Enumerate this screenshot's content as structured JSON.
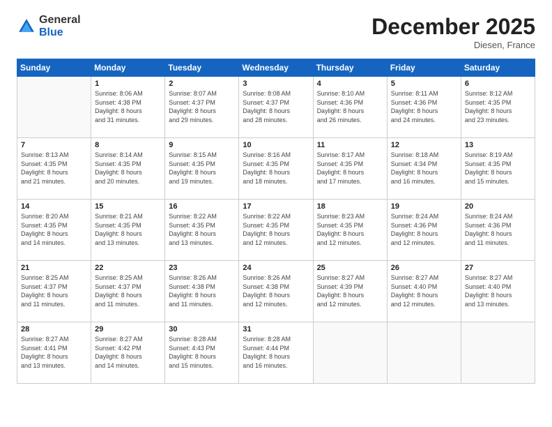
{
  "header": {
    "logo": {
      "general": "General",
      "blue": "Blue"
    },
    "title": "December 2025",
    "location": "Diesen, France"
  },
  "calendar": {
    "days_of_week": [
      "Sunday",
      "Monday",
      "Tuesday",
      "Wednesday",
      "Thursday",
      "Friday",
      "Saturday"
    ],
    "weeks": [
      [
        {
          "day": "",
          "info": ""
        },
        {
          "day": "1",
          "info": "Sunrise: 8:06 AM\nSunset: 4:38 PM\nDaylight: 8 hours\nand 31 minutes."
        },
        {
          "day": "2",
          "info": "Sunrise: 8:07 AM\nSunset: 4:37 PM\nDaylight: 8 hours\nand 29 minutes."
        },
        {
          "day": "3",
          "info": "Sunrise: 8:08 AM\nSunset: 4:37 PM\nDaylight: 8 hours\nand 28 minutes."
        },
        {
          "day": "4",
          "info": "Sunrise: 8:10 AM\nSunset: 4:36 PM\nDaylight: 8 hours\nand 26 minutes."
        },
        {
          "day": "5",
          "info": "Sunrise: 8:11 AM\nSunset: 4:36 PM\nDaylight: 8 hours\nand 24 minutes."
        },
        {
          "day": "6",
          "info": "Sunrise: 8:12 AM\nSunset: 4:35 PM\nDaylight: 8 hours\nand 23 minutes."
        }
      ],
      [
        {
          "day": "7",
          "info": "Sunrise: 8:13 AM\nSunset: 4:35 PM\nDaylight: 8 hours\nand 21 minutes."
        },
        {
          "day": "8",
          "info": "Sunrise: 8:14 AM\nSunset: 4:35 PM\nDaylight: 8 hours\nand 20 minutes."
        },
        {
          "day": "9",
          "info": "Sunrise: 8:15 AM\nSunset: 4:35 PM\nDaylight: 8 hours\nand 19 minutes."
        },
        {
          "day": "10",
          "info": "Sunrise: 8:16 AM\nSunset: 4:35 PM\nDaylight: 8 hours\nand 18 minutes."
        },
        {
          "day": "11",
          "info": "Sunrise: 8:17 AM\nSunset: 4:35 PM\nDaylight: 8 hours\nand 17 minutes."
        },
        {
          "day": "12",
          "info": "Sunrise: 8:18 AM\nSunset: 4:34 PM\nDaylight: 8 hours\nand 16 minutes."
        },
        {
          "day": "13",
          "info": "Sunrise: 8:19 AM\nSunset: 4:35 PM\nDaylight: 8 hours\nand 15 minutes."
        }
      ],
      [
        {
          "day": "14",
          "info": "Sunrise: 8:20 AM\nSunset: 4:35 PM\nDaylight: 8 hours\nand 14 minutes."
        },
        {
          "day": "15",
          "info": "Sunrise: 8:21 AM\nSunset: 4:35 PM\nDaylight: 8 hours\nand 13 minutes."
        },
        {
          "day": "16",
          "info": "Sunrise: 8:22 AM\nSunset: 4:35 PM\nDaylight: 8 hours\nand 13 minutes."
        },
        {
          "day": "17",
          "info": "Sunrise: 8:22 AM\nSunset: 4:35 PM\nDaylight: 8 hours\nand 12 minutes."
        },
        {
          "day": "18",
          "info": "Sunrise: 8:23 AM\nSunset: 4:35 PM\nDaylight: 8 hours\nand 12 minutes."
        },
        {
          "day": "19",
          "info": "Sunrise: 8:24 AM\nSunset: 4:36 PM\nDaylight: 8 hours\nand 12 minutes."
        },
        {
          "day": "20",
          "info": "Sunrise: 8:24 AM\nSunset: 4:36 PM\nDaylight: 8 hours\nand 11 minutes."
        }
      ],
      [
        {
          "day": "21",
          "info": "Sunrise: 8:25 AM\nSunset: 4:37 PM\nDaylight: 8 hours\nand 11 minutes."
        },
        {
          "day": "22",
          "info": "Sunrise: 8:25 AM\nSunset: 4:37 PM\nDaylight: 8 hours\nand 11 minutes."
        },
        {
          "day": "23",
          "info": "Sunrise: 8:26 AM\nSunset: 4:38 PM\nDaylight: 8 hours\nand 11 minutes."
        },
        {
          "day": "24",
          "info": "Sunrise: 8:26 AM\nSunset: 4:38 PM\nDaylight: 8 hours\nand 12 minutes."
        },
        {
          "day": "25",
          "info": "Sunrise: 8:27 AM\nSunset: 4:39 PM\nDaylight: 8 hours\nand 12 minutes."
        },
        {
          "day": "26",
          "info": "Sunrise: 8:27 AM\nSunset: 4:40 PM\nDaylight: 8 hours\nand 12 minutes."
        },
        {
          "day": "27",
          "info": "Sunrise: 8:27 AM\nSunset: 4:40 PM\nDaylight: 8 hours\nand 13 minutes."
        }
      ],
      [
        {
          "day": "28",
          "info": "Sunrise: 8:27 AM\nSunset: 4:41 PM\nDaylight: 8 hours\nand 13 minutes."
        },
        {
          "day": "29",
          "info": "Sunrise: 8:27 AM\nSunset: 4:42 PM\nDaylight: 8 hours\nand 14 minutes."
        },
        {
          "day": "30",
          "info": "Sunrise: 8:28 AM\nSunset: 4:43 PM\nDaylight: 8 hours\nand 15 minutes."
        },
        {
          "day": "31",
          "info": "Sunrise: 8:28 AM\nSunset: 4:44 PM\nDaylight: 8 hours\nand 16 minutes."
        },
        {
          "day": "",
          "info": ""
        },
        {
          "day": "",
          "info": ""
        },
        {
          "day": "",
          "info": ""
        }
      ]
    ]
  }
}
